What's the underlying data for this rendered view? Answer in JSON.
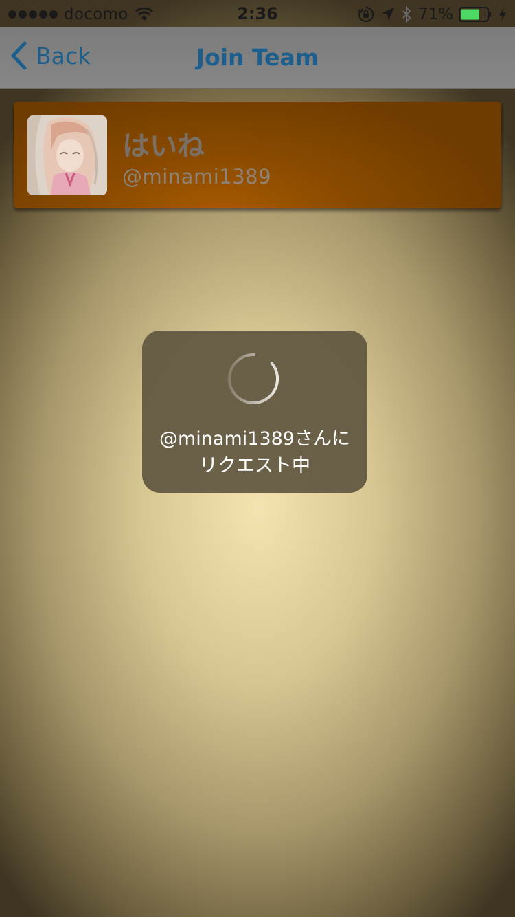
{
  "status_bar": {
    "carrier": "docomo",
    "signal_bars": 5,
    "time": "2:36",
    "battery_percent": "71%",
    "battery_level": 0.71,
    "icons": [
      "signal-dots-icon",
      "wifi-icon",
      "orientation-lock-icon",
      "location-arrow-icon",
      "bluetooth-icon",
      "battery-icon",
      "charging-bolt-icon"
    ]
  },
  "nav": {
    "back_label": "Back",
    "title": "Join Team",
    "tint_color": "#1d5f8c"
  },
  "user_card": {
    "display_name": "はいね",
    "handle": "@minami1389",
    "accent_color": "#a95b00"
  },
  "loading": {
    "line1": "@minami1389さんに",
    "line2": "リクエスト中"
  }
}
